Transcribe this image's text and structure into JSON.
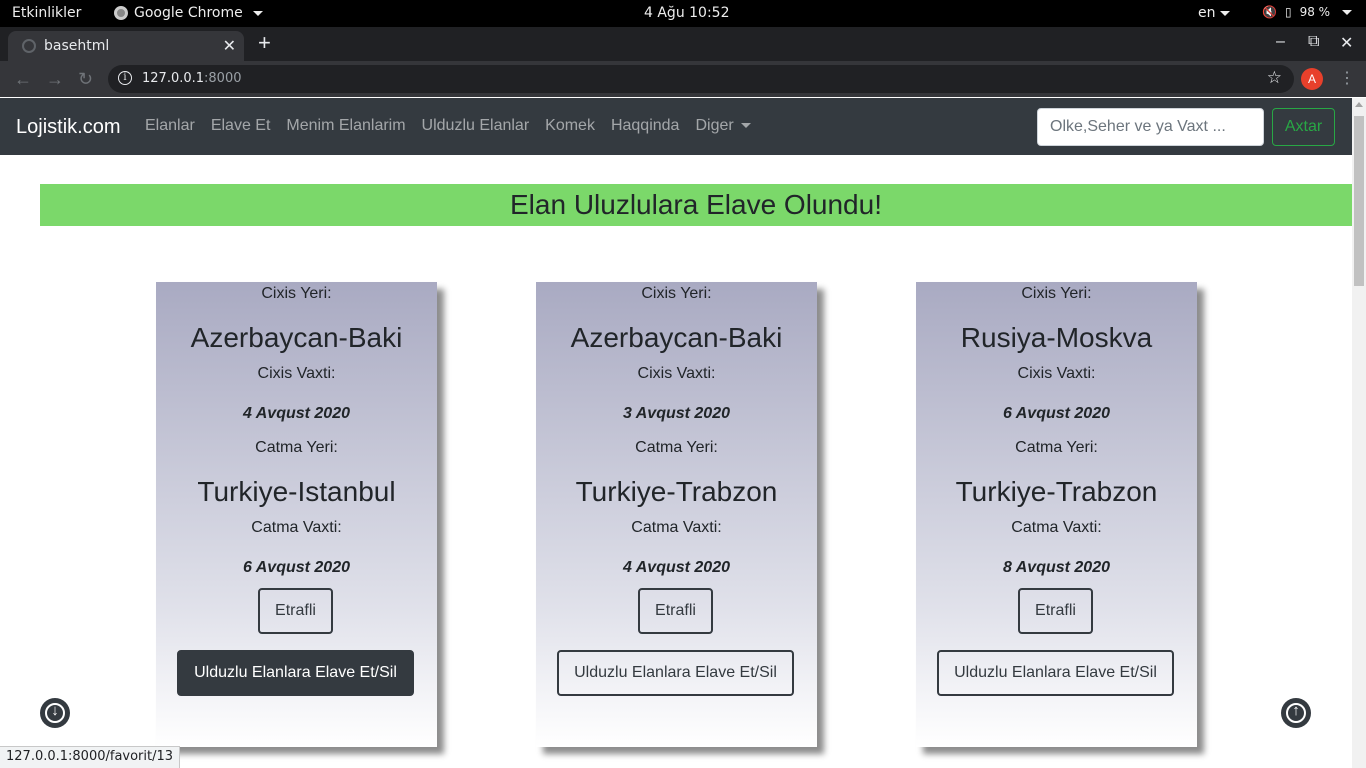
{
  "os_bar": {
    "activities": "Etkinlikler",
    "app_name": "Google Chrome",
    "clock": "4 Ağu  10:52",
    "lang": "en",
    "battery": "98 %"
  },
  "browser": {
    "tab_title": "basehtml",
    "url_host": "127.0.0.1",
    "url_port": ":8000",
    "avatar_letter": "A",
    "status_url": "127.0.0.1:8000/favorit/13"
  },
  "navbar": {
    "brand": "Lojistik.com",
    "links": [
      "Elanlar",
      "Elave Et",
      "Menim Elanlarim",
      "Ulduzlu Elanlar",
      "Komek",
      "Haqqinda",
      "Diger"
    ],
    "search_placeholder": "Olke,Seher ve ya Vaxt ...",
    "search_button": "Axtar"
  },
  "alert": {
    "message": "Elan Uluzlulara Elave Olundu!",
    "color": "#7bd86a"
  },
  "card_labels": {
    "departure_place": "Cixis Yeri:",
    "departure_time": "Cixis Vaxti:",
    "arrival_place": "Catma Yeri:",
    "arrival_time": "Catma Vaxti:",
    "details_button": "Etrafli",
    "favorite_button": "Ulduzlu Elanlara Elave Et/Sil"
  },
  "cards": [
    {
      "from": "Azerbaycan-Baki",
      "depart_date": "4 Avqust 2020",
      "to": "Turkiye-Istanbul",
      "arrive_date": "6 Avqust 2020",
      "favorite_active": true
    },
    {
      "from": "Azerbaycan-Baki",
      "depart_date": "3 Avqust 2020",
      "to": "Turkiye-Trabzon",
      "arrive_date": "4 Avqust 2020",
      "favorite_active": false
    },
    {
      "from": "Rusiya-Moskva",
      "depart_date": "6 Avqust 2020",
      "to": "Turkiye-Trabzon",
      "arrive_date": "8 Avqust 2020",
      "favorite_active": false
    }
  ]
}
